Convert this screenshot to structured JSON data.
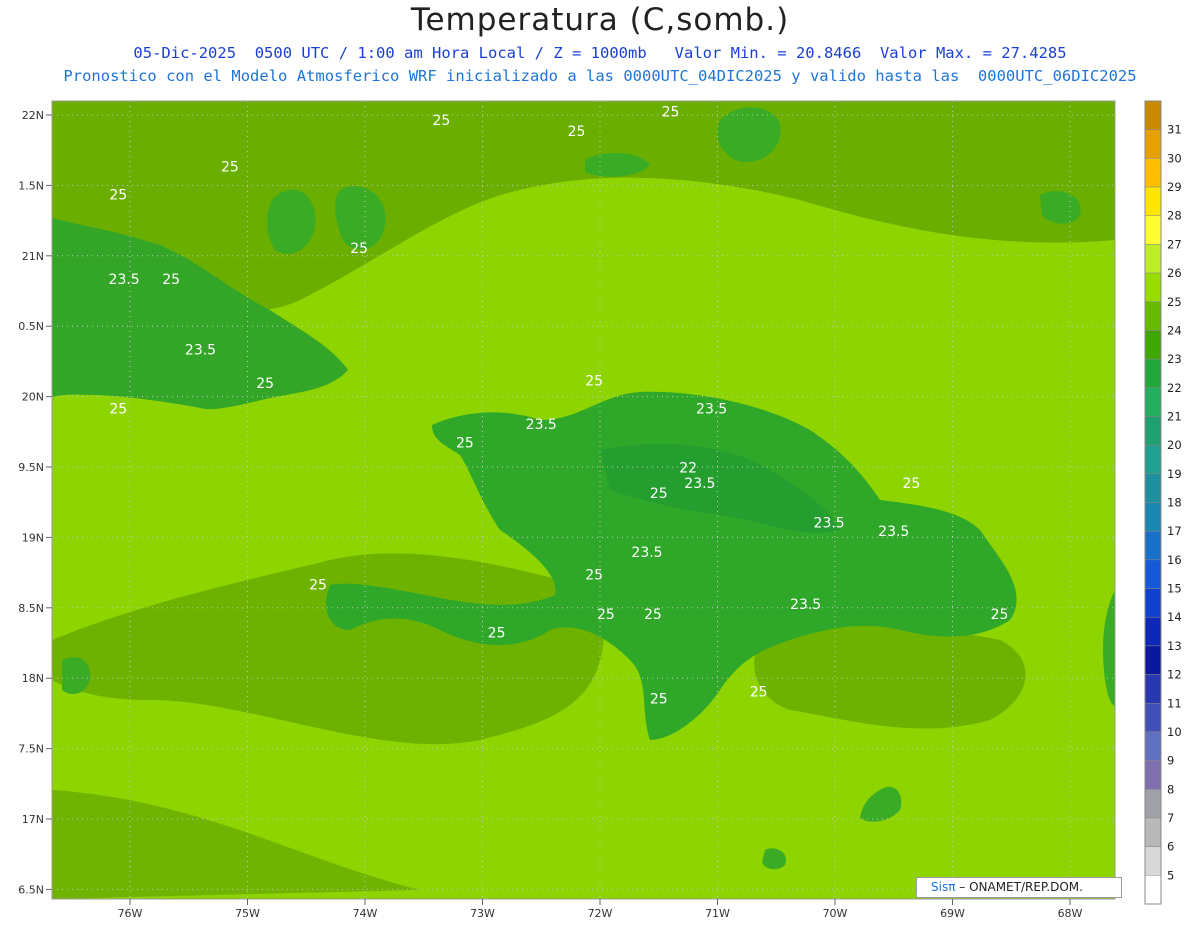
{
  "header": {
    "title": "Temperatura (C,somb.)",
    "line1": "05-Dic-2025  0500 UTC / 1:00 am Hora Local / Z = 1000mb   Valor Min. = 20.8466  Valor Max. = 27.4285",
    "line2": "Pronostico con el Modelo Atmosferico WRF inicializado a las 0000UTC_04DIC2025 y valido hasta las  0000UTC_06DIC2025"
  },
  "axes": {
    "lat_labels": [
      "22N",
      "1.5N",
      "21N",
      "0.5N",
      "20N",
      "9.5N",
      "19N",
      "8.5N",
      "18N",
      "7.5N",
      "17N",
      "6.5N"
    ],
    "lon_labels": [
      "76W",
      "75W",
      "74W",
      "73W",
      "72W",
      "71W",
      "70W",
      "69W",
      "68W"
    ]
  },
  "contour_labels": [
    {
      "text": "25",
      "lon": -73.35,
      "lat": 21.93
    },
    {
      "text": "25",
      "lon": -72.2,
      "lat": 21.85
    },
    {
      "text": "25",
      "lon": -71.4,
      "lat": 21.99
    },
    {
      "text": "25",
      "lon": -75.15,
      "lat": 21.6
    },
    {
      "text": "25",
      "lon": -76.1,
      "lat": 21.4
    },
    {
      "text": "25",
      "lon": -74.05,
      "lat": 21.02
    },
    {
      "text": "23.5",
      "lon": -76.05,
      "lat": 20.8
    },
    {
      "text": "25",
      "lon": -75.65,
      "lat": 20.8
    },
    {
      "text": "23.5",
      "lon": -75.4,
      "lat": 20.3
    },
    {
      "text": "25",
      "lon": -74.85,
      "lat": 20.06
    },
    {
      "text": "25",
      "lon": -76.1,
      "lat": 19.88
    },
    {
      "text": "25",
      "lon": -72.05,
      "lat": 20.08
    },
    {
      "text": "23.5",
      "lon": -71.05,
      "lat": 19.88
    },
    {
      "text": "23.5",
      "lon": -72.5,
      "lat": 19.77
    },
    {
      "text": "25",
      "lon": -73.15,
      "lat": 19.64
    },
    {
      "text": "22",
      "lon": -71.25,
      "lat": 19.46
    },
    {
      "text": "25",
      "lon": -71.5,
      "lat": 19.28
    },
    {
      "text": "23.5",
      "lon": -71.15,
      "lat": 19.35
    },
    {
      "text": "25",
      "lon": -69.35,
      "lat": 19.35
    },
    {
      "text": "23.5",
      "lon": -70.05,
      "lat": 19.07
    },
    {
      "text": "23.5",
      "lon": -69.5,
      "lat": 19.01
    },
    {
      "text": "23.5",
      "lon": -71.6,
      "lat": 18.86
    },
    {
      "text": "25",
      "lon": -72.05,
      "lat": 18.7
    },
    {
      "text": "25",
      "lon": -74.4,
      "lat": 18.63
    },
    {
      "text": "23.5",
      "lon": -70.25,
      "lat": 18.49
    },
    {
      "text": "25",
      "lon": -71.95,
      "lat": 18.42
    },
    {
      "text": "25",
      "lon": -71.55,
      "lat": 18.42
    },
    {
      "text": "25",
      "lon": -68.6,
      "lat": 18.42
    },
    {
      "text": "25",
      "lon": -72.88,
      "lat": 18.29
    },
    {
      "text": "25",
      "lon": -70.65,
      "lat": 17.87
    },
    {
      "text": "25",
      "lon": -71.5,
      "lat": 17.82
    }
  ],
  "colorbar": {
    "labels": [
      "31",
      "30",
      "29",
      "28",
      "27",
      "26",
      "25",
      "24",
      "23",
      "22",
      "21",
      "20",
      "19",
      "18",
      "17",
      "16",
      "15",
      "14",
      "13",
      "12",
      "11",
      "10",
      "9",
      "8",
      "7",
      "6",
      "5"
    ],
    "colors": [
      "#c98a00",
      "#e6a000",
      "#ffbf00",
      "#ffe600",
      "#ffff33",
      "#bfee26",
      "#99dd00",
      "#66bb00",
      "#3fa800",
      "#22a83a",
      "#22b060",
      "#1fa070",
      "#20a090",
      "#1e8f9f",
      "#1a88b0",
      "#1870c8",
      "#1558d8",
      "#1040d0",
      "#0d28b8",
      "#0a18a0",
      "#2838b0",
      "#4050b8",
      "#6070c0",
      "#8070b0",
      "#a0a0a8",
      "#b8b8b8",
      "#d8d8d8",
      "#ffffff"
    ]
  },
  "credit": {
    "brand": "Sisπ",
    "text": " – ONAMET/REP.DOM."
  }
}
